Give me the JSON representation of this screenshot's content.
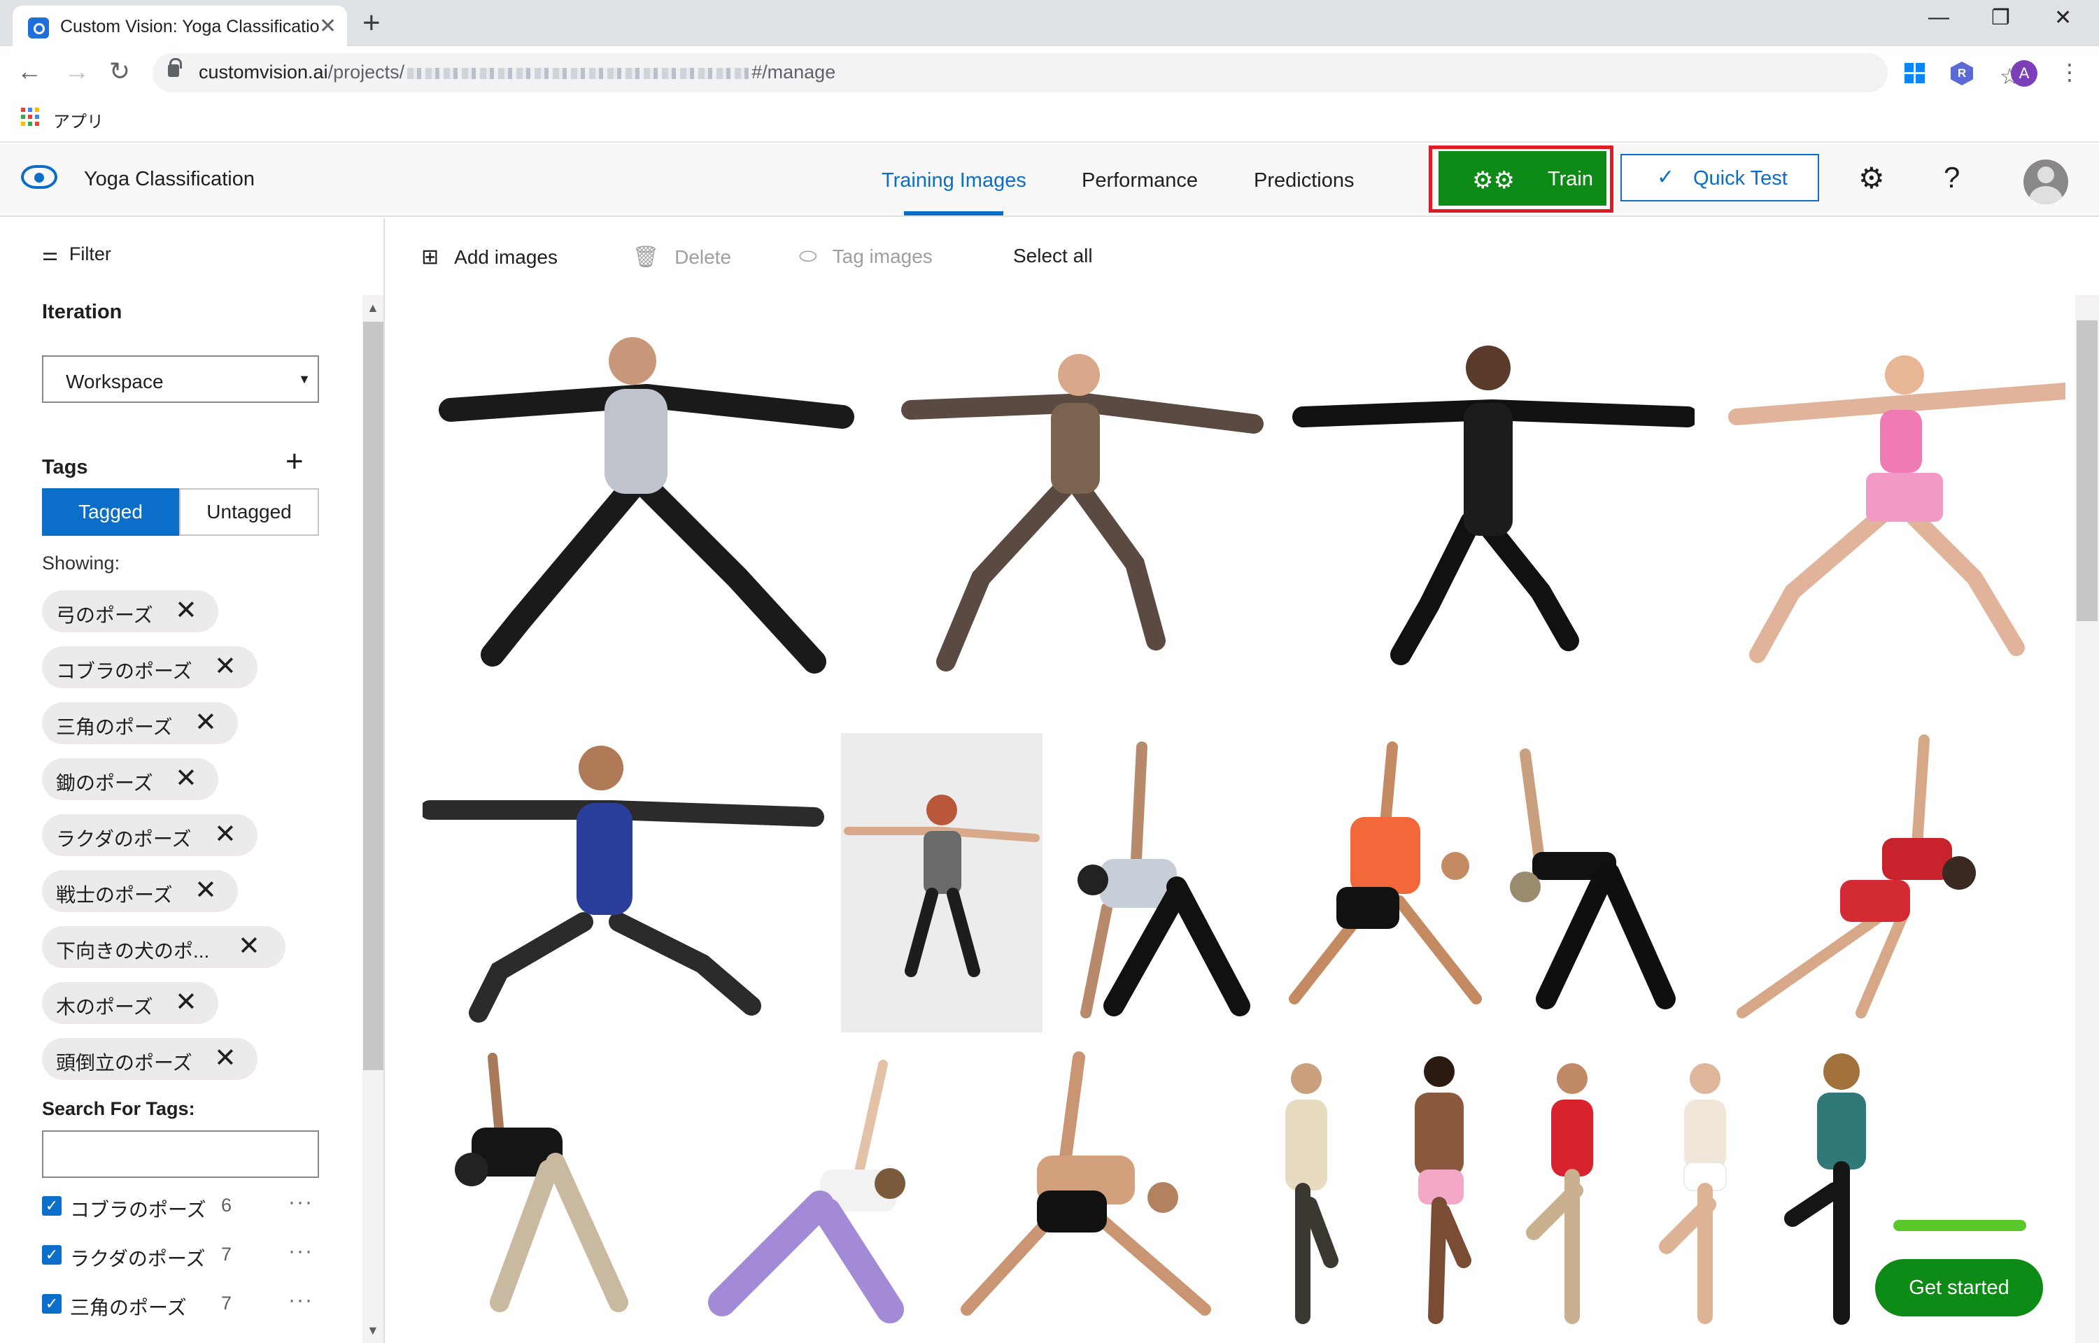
{
  "browser": {
    "tab_title": "Custom Vision: Yoga Classificatio",
    "url_host": "customvision.ai",
    "url_path_prefix": "/projects/",
    "url_path_suffix": "#/manage",
    "bookmark_apps_label": "アプリ",
    "profile_initial": "A"
  },
  "header": {
    "project_title": "Yoga Classification",
    "tabs": [
      "Training Images",
      "Performance",
      "Predictions"
    ],
    "active_tab": "Training Images",
    "train_label": "Train",
    "quick_test_label": "Quick Test"
  },
  "sidebar": {
    "filter_label": "Filter",
    "iteration_title": "Iteration",
    "iteration_value": "Workspace",
    "tags_title": "Tags",
    "tagged_label": "Tagged",
    "untagged_label": "Untagged",
    "showing_label": "Showing:",
    "chips": [
      "弓のポーズ",
      "コブラのポーズ",
      "三角のポーズ",
      "鋤のポーズ",
      "ラクダのポーズ",
      "戦士のポーズ",
      "下向きの犬のポ...",
      "木のポーズ",
      "頭倒立のポーズ"
    ],
    "search_label": "Search For Tags:",
    "search_value": "",
    "tag_list": [
      {
        "name": "コブラのポーズ",
        "count": "6"
      },
      {
        "name": "ラクダのポーズ",
        "count": "7"
      },
      {
        "name": "三角のポーズ",
        "count": "7"
      }
    ]
  },
  "toolbar": {
    "add_images": "Add images",
    "delete": "Delete",
    "tag_images": "Tag images",
    "select_all": "Select all"
  },
  "get_started_label": "Get started",
  "colors": {
    "accent": "#0b6ec9",
    "train_green": "#0e8a16",
    "highlight_red": "#e01b24"
  }
}
